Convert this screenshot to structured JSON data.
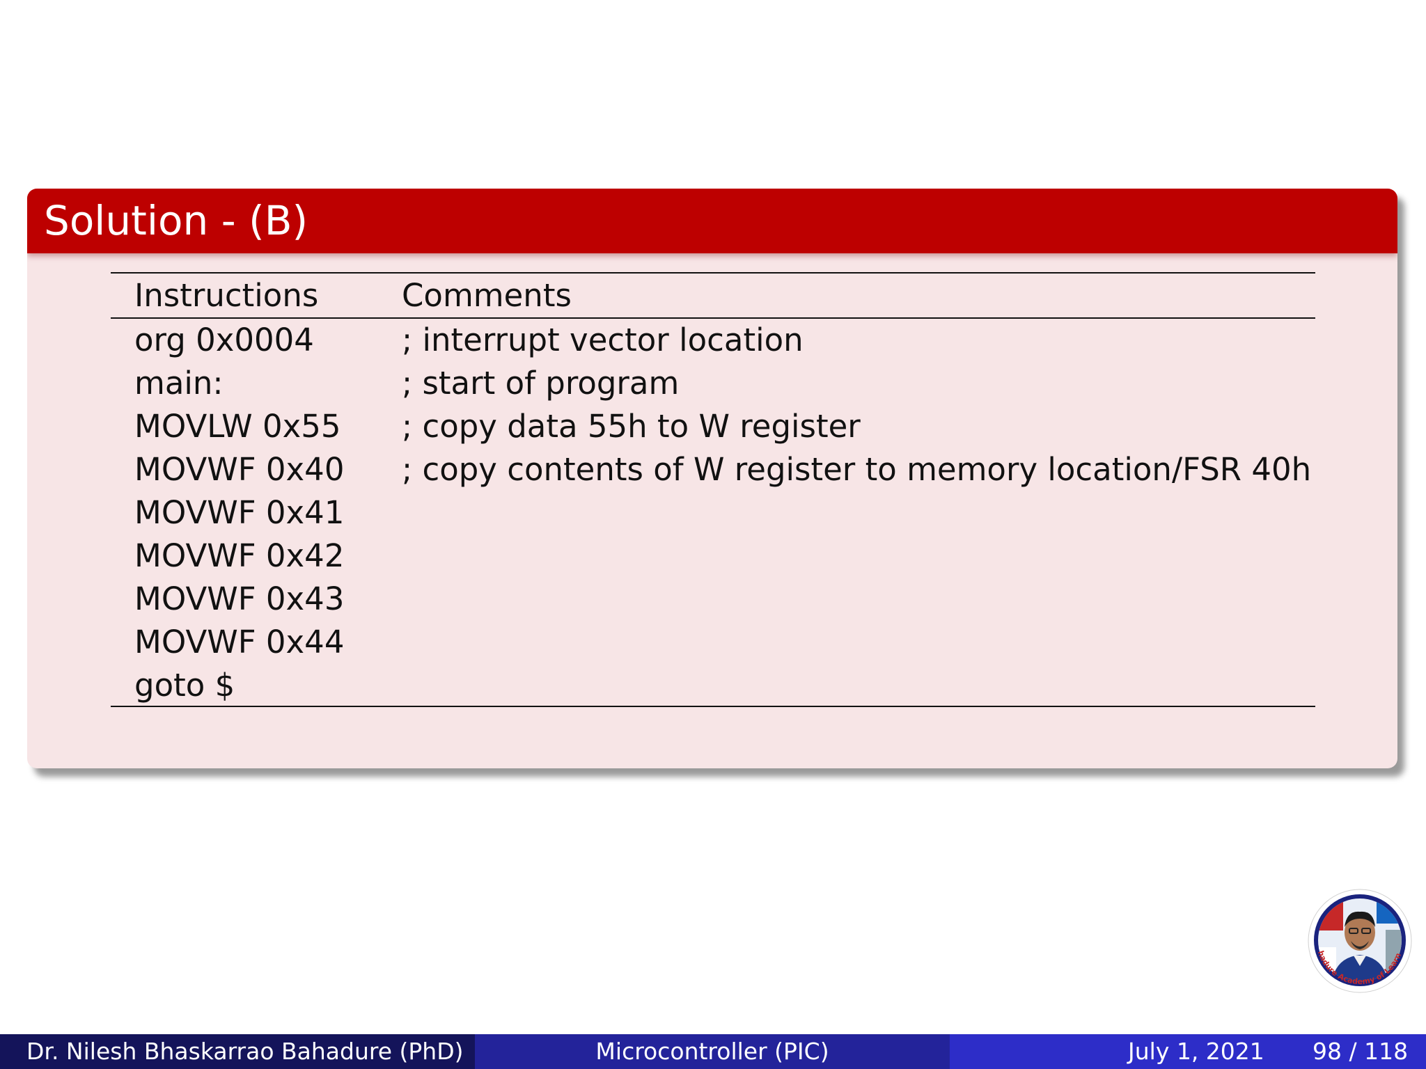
{
  "block": {
    "title": "Solution - (B)"
  },
  "table": {
    "headers": {
      "instructions": "Instructions",
      "comments": "Comments"
    },
    "rows": [
      {
        "instruction": "org 0x0004",
        "comment": "; interrupt vector location"
      },
      {
        "instruction": "main:",
        "comment": "; start of program"
      },
      {
        "instruction": "MOVLW 0x55",
        "comment": "; copy data 55h to W register"
      },
      {
        "instruction": "MOVWF 0x40",
        "comment": "; copy contents of W register to memory location/FSR 40h"
      },
      {
        "instruction": "MOVWF 0x41",
        "comment": ""
      },
      {
        "instruction": "MOVWF 0x42",
        "comment": ""
      },
      {
        "instruction": "MOVWF 0x43",
        "comment": ""
      },
      {
        "instruction": "MOVWF 0x44",
        "comment": ""
      },
      {
        "instruction": "goto $",
        "comment": ""
      }
    ]
  },
  "logo": {
    "ring_text": "Bahadure Academy of Learning"
  },
  "footer": {
    "author": "Dr. Nilesh Bhaskarrao Bahadure  (PhD)",
    "course": "Microcontroller (PIC)",
    "date": "July 1, 2021",
    "page": "98 / 118"
  },
  "colors": {
    "block_title_bg": "#bd0000",
    "block_body_bg": "#f7e5e6",
    "footer_left": "#14145a",
    "footer_mid": "#23239a",
    "footer_right": "#2d2dc8"
  }
}
